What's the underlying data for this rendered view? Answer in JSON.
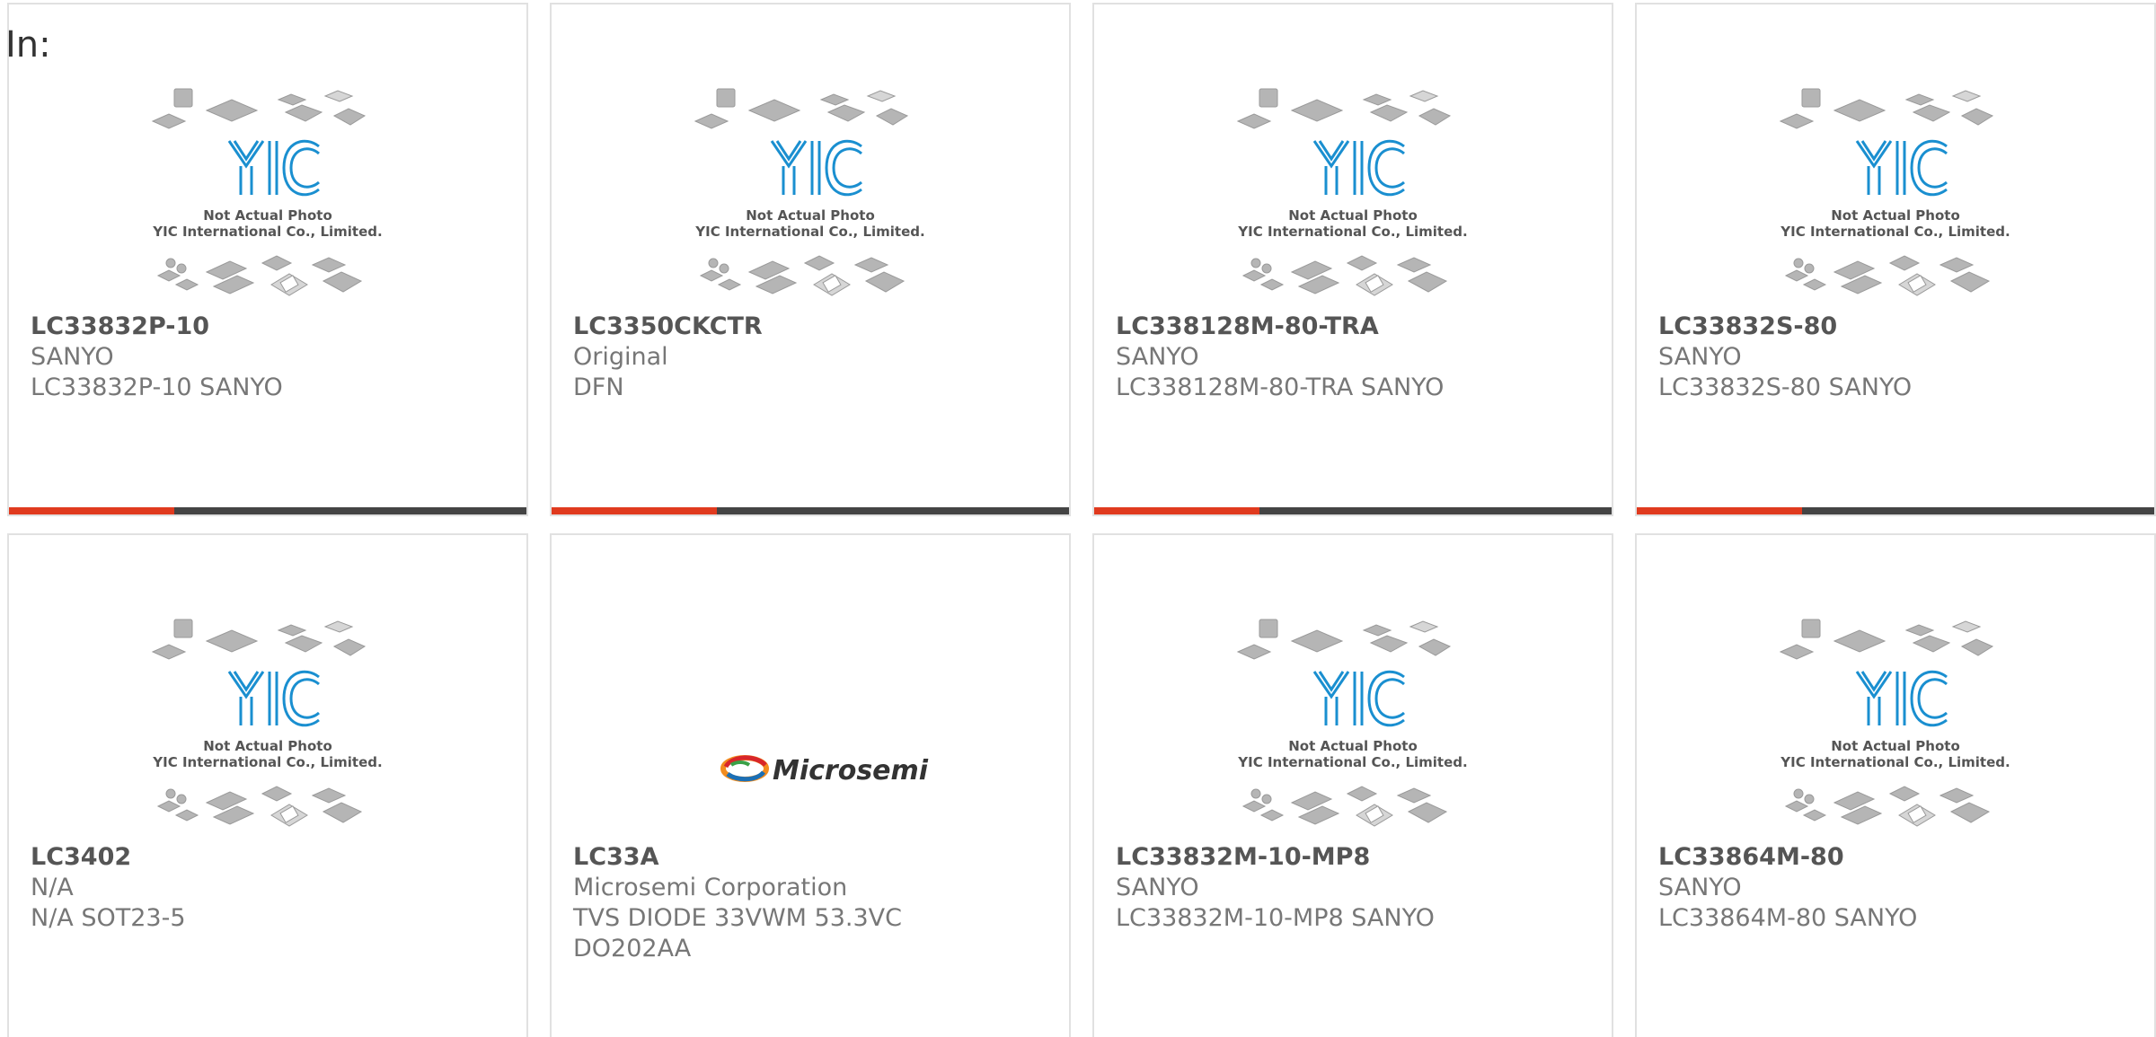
{
  "header": {
    "prefix": "In:"
  },
  "placeholder": {
    "line1": "Not Actual Photo",
    "line2": "YIC International Co., Limited.",
    "logo": "YIC"
  },
  "products": [
    {
      "part": "LC33832P-10",
      "lines": [
        "SANYO",
        "LC33832P-10 SANYO"
      ],
      "image": "yic-placeholder",
      "progress": 0.32
    },
    {
      "part": "LC3350CKCTR",
      "lines": [
        "Original",
        "DFN"
      ],
      "image": "yic-placeholder",
      "progress": 0.32
    },
    {
      "part": "LC338128M-80-TRA",
      "lines": [
        "SANYO",
        "LC338128M-80-TRA SANYO"
      ],
      "image": "yic-placeholder",
      "progress": 0.32
    },
    {
      "part": "LC33832S-80",
      "lines": [
        "SANYO",
        "LC33832S-80 SANYO"
      ],
      "image": "yic-placeholder",
      "progress": 0.32
    },
    {
      "part": "LC3402",
      "lines": [
        "N/A",
        "N/A SOT23-5"
      ],
      "image": "yic-placeholder",
      "progress": 0
    },
    {
      "part": "LC33A",
      "lines": [
        "Microsemi Corporation",
        "TVS DIODE 33VWM 53.3VC",
        "DO202AA"
      ],
      "image": "microsemi-logo",
      "brand": "Microsemi",
      "progress": 0
    },
    {
      "part": "LC33832M-10-MP8",
      "lines": [
        "SANYO",
        "LC33832M-10-MP8 SANYO"
      ],
      "image": "yic-placeholder",
      "progress": 0
    },
    {
      "part": "LC33864M-80",
      "lines": [
        "SANYO",
        "LC33864M-80 SANYO"
      ],
      "image": "yic-placeholder",
      "progress": 0
    }
  ],
  "colors": {
    "progress_fill": "#e03a1e",
    "progress_track": "#444444",
    "logo_blue": "#1a8fd0"
  }
}
